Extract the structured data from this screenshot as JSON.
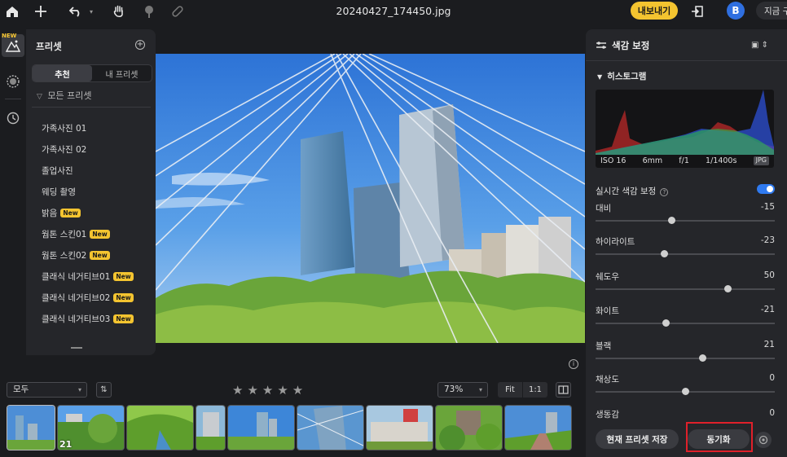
{
  "window": {
    "title": "20240427_174450.jpg",
    "export_label": "내보내기",
    "avatar_letter": "B",
    "now_label": "지금 구"
  },
  "left_rail": {
    "new_tag": "NEW"
  },
  "preset_panel": {
    "title": "프리셋",
    "tabs": [
      {
        "label": "추천",
        "active": true
      },
      {
        "label": "내 프리셋",
        "active": false
      }
    ],
    "filter_label": "모든 프리셋",
    "items": [
      {
        "label": "가족사진 01",
        "badge": ""
      },
      {
        "label": "가족사진 02",
        "badge": ""
      },
      {
        "label": "졸업사진",
        "badge": ""
      },
      {
        "label": "웨딩 촬영",
        "badge": ""
      },
      {
        "label": "밝음",
        "badge": "New"
      },
      {
        "label": "웜톤 스킨01",
        "badge": "New"
      },
      {
        "label": "웜톤 스킨02",
        "badge": "New"
      },
      {
        "label": "클래식 네거티브01",
        "badge": "New"
      },
      {
        "label": "클래식 네거티브02",
        "badge": "New"
      },
      {
        "label": "클래식 네거티브03",
        "badge": "New"
      }
    ]
  },
  "filmstrip": {
    "filter_value": "모두",
    "zoom_value": "73%",
    "fit_label": "Fit",
    "one_to_one_label": "1:1",
    "thumb_badge": "21"
  },
  "right_panel": {
    "title": "색감 보정",
    "histogram_label": "히스토그램",
    "exif": {
      "iso": "ISO 16",
      "focal": "6mm",
      "aperture": "f/1",
      "shutter": "1/1400s",
      "format": "JPG"
    },
    "realtime_label": "실시간 색감 보정",
    "realtime_on": true,
    "sliders": [
      {
        "label": "대비",
        "value": "-15",
        "level": 0.42
      },
      {
        "label": "하이라이트",
        "value": "-23",
        "level": 0.38
      },
      {
        "label": "쉐도우",
        "value": "50",
        "level": 0.75
      },
      {
        "label": "화이트",
        "value": "-21",
        "level": 0.39
      },
      {
        "label": "블랙",
        "value": "21",
        "level": 0.6
      },
      {
        "label": "채상도",
        "value": "0",
        "level": 0.5
      },
      {
        "label": "생동감",
        "value": "0",
        "level": 0.5
      }
    ],
    "save_preset_label": "현재 프리셋 저장",
    "sync_label": "동기화"
  },
  "colors": {
    "accent": "#f4c430",
    "toggle_on": "#2f7af0",
    "highlight_outline": "#e0202a"
  }
}
